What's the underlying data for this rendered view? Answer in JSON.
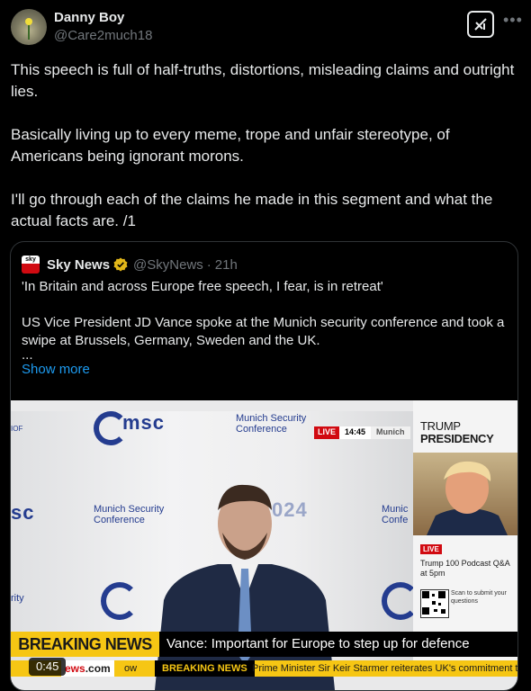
{
  "tweet": {
    "author_name": "Danny Boy",
    "author_handle": "@Care2much18",
    "more_icon": "•••",
    "paragraphs": [
      "This speech is full of half-truths, distortions, misleading claims and outright lies.",
      "Basically living up to every meme, trope and unfair stereotype, of Americans being ignorant morons.",
      "I'll go through each of the claims he made in this segment and what the actual facts are. /1"
    ]
  },
  "quoted": {
    "logo_text": "sky",
    "name": "Sky News",
    "handle": "@SkyNews",
    "separator": "·",
    "time": "21h",
    "paragraphs": [
      "'In Britain and across Europe free speech, I fear, is in retreat'",
      "US Vice President JD Vance spoke at the Munich security conference and took a swipe at Brussels, Germany, Sweden and the UK."
    ],
    "ellipsis": "...",
    "show_more": "Show more"
  },
  "video": {
    "msc_logo": "msc",
    "msc_subtitle_top": "Munich Security Conference",
    "msc_subtitle_left": "Munich Security Conference",
    "msc_subtitle_right": "Munic Confe",
    "backdrop_year": "024",
    "side_fragment_1": "IOF",
    "side_fragment_2": "sc",
    "side_fragment_3": "rity",
    "live_label": "LIVE",
    "live_time": "14:45",
    "live_location": "Munich",
    "panel_title_1": "TRUMP",
    "panel_title_2": "PRESIDENCY",
    "panel_live": "LIVE",
    "panel_text": "Trump 100 Podcast Q&A at 5pm",
    "panel_scan": "Scan to submit your questions",
    "breaking_label": "BREAKING NEWS",
    "breaking_text": "Vance: Important for Europe to step up for defence",
    "ticker_sky_red": "ews",
    "ticker_sky": ".com",
    "ticker_now": "ow",
    "ticker_breaking": "BREAKING NEWS",
    "ticker_text": "Prime Minister Sir Keir Starmer reiterates UK's commitment to",
    "duration": "0:45"
  },
  "colors": {
    "background": "#000000",
    "text": "#e7e9ea",
    "muted": "#71767b",
    "link": "#1d9bf0",
    "sky_red": "#d10a11",
    "breaking_yellow": "#f6c614",
    "msc_blue": "#243c8f"
  }
}
